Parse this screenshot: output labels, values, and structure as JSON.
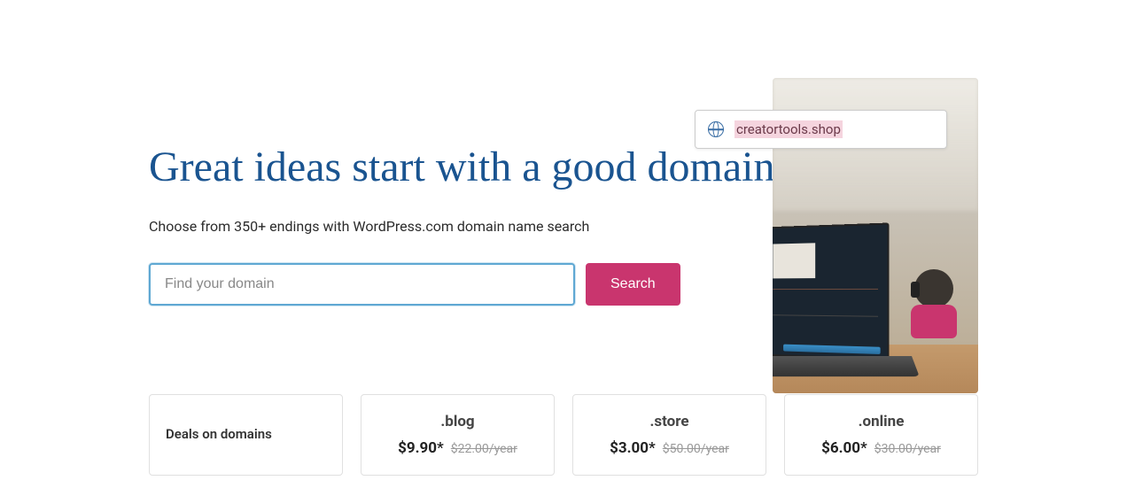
{
  "hero": {
    "headline": "Great ideas start with a good domain name",
    "subheadline": "Choose from 350+ endings with WordPress.com domain name search",
    "search_placeholder": "Find your domain",
    "search_button": "Search"
  },
  "addressbar": {
    "domain": "creatortools.shop"
  },
  "deals": {
    "title": "Deals on domains",
    "items": [
      {
        "ext": ".blog",
        "price": "$9.90*",
        "old": "$22.00/year"
      },
      {
        "ext": ".store",
        "price": "$3.00*",
        "old": "$50.00/year"
      },
      {
        "ext": ".online",
        "price": "$6.00*",
        "old": "$30.00/year"
      }
    ]
  }
}
